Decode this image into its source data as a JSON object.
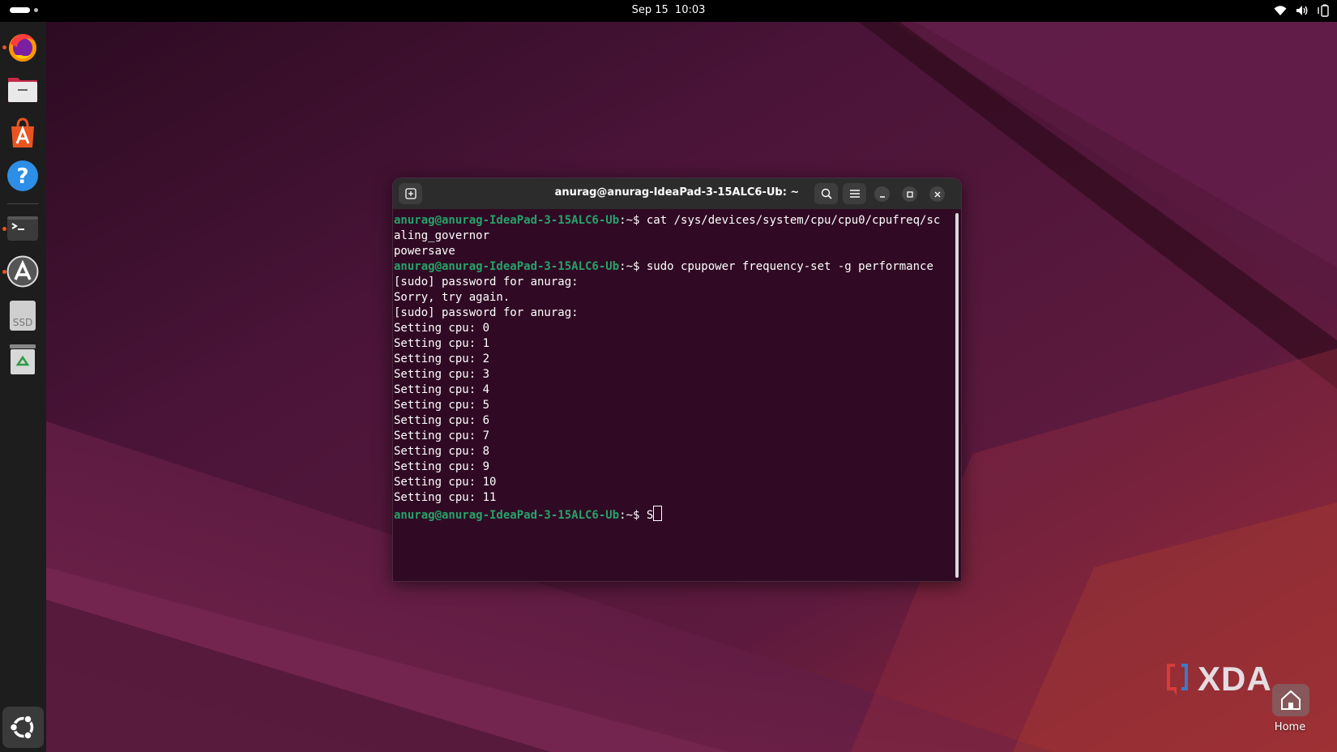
{
  "topbar": {
    "date": "Sep 15",
    "time": "10:03"
  },
  "dock": {
    "items": [
      {
        "icon": "firefox-icon",
        "running": true
      },
      {
        "icon": "files-icon",
        "running": false
      },
      {
        "icon": "app-center-icon",
        "running": false
      },
      {
        "icon": "help-icon",
        "running": false
      },
      {
        "icon": "terminal-icon",
        "running": true
      },
      {
        "icon": "software-updater-icon",
        "running": true
      },
      {
        "icon": "ssd-drive-icon",
        "label": "SSD",
        "running": false
      },
      {
        "icon": "trash-icon",
        "running": false
      }
    ]
  },
  "terminal": {
    "title": "anurag@anurag-IdeaPad-3-15ALC6-Ub: ~",
    "prompt": "anurag@anurag-IdeaPad-3-15ALC6-Ub",
    "cwd": "~",
    "lines": [
      {
        "prompt": true,
        "text": "cat /sys/devices/system/cpu/cpu0/cpufreq/sc"
      },
      {
        "prompt": false,
        "text": "aling_governor"
      },
      {
        "prompt": false,
        "text": "powersave"
      },
      {
        "prompt": true,
        "text": "sudo cpupower frequency-set -g performance"
      },
      {
        "prompt": false,
        "text": "[sudo] password for anurag:"
      },
      {
        "prompt": false,
        "text": "Sorry, try again."
      },
      {
        "prompt": false,
        "text": "[sudo] password for anurag:"
      },
      {
        "prompt": false,
        "text": "Setting cpu: 0"
      },
      {
        "prompt": false,
        "text": "Setting cpu: 1"
      },
      {
        "prompt": false,
        "text": "Setting cpu: 2"
      },
      {
        "prompt": false,
        "text": "Setting cpu: 3"
      },
      {
        "prompt": false,
        "text": "Setting cpu: 4"
      },
      {
        "prompt": false,
        "text": "Setting cpu: 5"
      },
      {
        "prompt": false,
        "text": "Setting cpu: 6"
      },
      {
        "prompt": false,
        "text": "Setting cpu: 7"
      },
      {
        "prompt": false,
        "text": "Setting cpu: 8"
      },
      {
        "prompt": false,
        "text": "Setting cpu: 9"
      },
      {
        "prompt": false,
        "text": "Setting cpu: 10"
      },
      {
        "prompt": false,
        "text": "Setting cpu: 11"
      }
    ],
    "current_input": "S",
    "colors": {
      "background": "#300a24",
      "prompt": "#26a269",
      "text": "#ffffff"
    }
  },
  "watermark": {
    "text": "XDA"
  },
  "desktop": {
    "home_label": "Home"
  }
}
